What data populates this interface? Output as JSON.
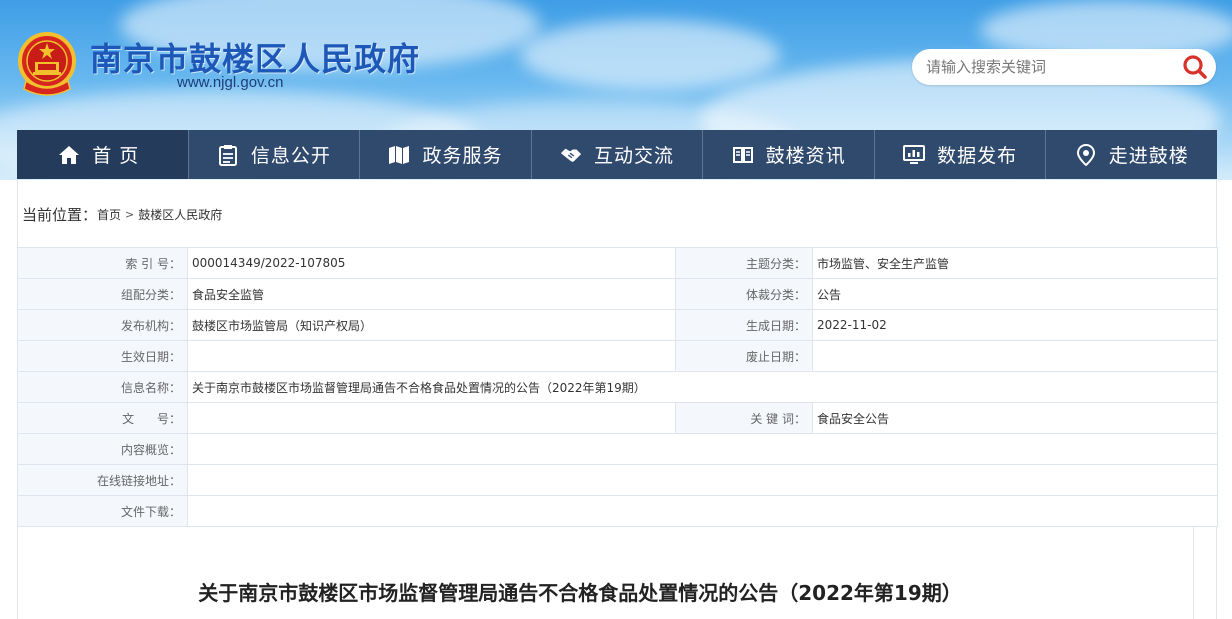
{
  "header": {
    "site_title": "南京市鼓楼区人民政府",
    "site_url": "www.njgl.gov.cn",
    "search_placeholder": "请输入搜索关键词"
  },
  "nav": {
    "items": [
      {
        "label": "首页",
        "icon": "home-icon"
      },
      {
        "label": "信息公开",
        "icon": "document-icon"
      },
      {
        "label": "政务服务",
        "icon": "map-icon"
      },
      {
        "label": "互动交流",
        "icon": "handshake-icon"
      },
      {
        "label": "鼓楼资讯",
        "icon": "book-icon"
      },
      {
        "label": "数据发布",
        "icon": "monitor-chart-icon"
      },
      {
        "label": "走进鼓楼",
        "icon": "location-pin-icon"
      }
    ]
  },
  "breadcrumb": {
    "prefix": "当前位置：",
    "home": "首页",
    "separator": ">",
    "current": "鼓楼区人民政府"
  },
  "meta": {
    "index_label": "索 引 号：",
    "index_value": "000014349/2022-107805",
    "topic_label": "主题分类：",
    "topic_value": "市场监管、安全生产监管",
    "group_label": "组配分类：",
    "group_value": "食品安全监管",
    "genre_label": "体裁分类：",
    "genre_value": "公告",
    "issuer_label": "发布机构：",
    "issuer_value": "鼓楼区市场监管局（知识产权局）",
    "created_label": "生成日期：",
    "created_value": "2022-11-02",
    "effective_label": "生效日期：",
    "effective_value": "",
    "expiry_label": "废止日期：",
    "expiry_value": "",
    "name_label": "信息名称：",
    "name_value": "关于南京市鼓楼区市场监督管理局通告不合格食品处置情况的公告（2022年第19期）",
    "docno_label": "文      号：",
    "docno_value": "",
    "keywords_label": "关 键 词：",
    "keywords_value": "食品安全公告",
    "summary_label": "内容概览：",
    "summary_value": "",
    "link_label": "在线链接地址：",
    "link_value": "",
    "download_label": "文件下载：",
    "download_value": ""
  },
  "article": {
    "title": "关于南京市鼓楼区市场监督管理局通告不合格食品处置情况的公告（2022年第19期）"
  },
  "colors": {
    "nav_bg": "#304a6e",
    "title_blue": "#1d58b8",
    "search_icon_red": "#d9322b",
    "label_bg": "#f4f8fd"
  }
}
